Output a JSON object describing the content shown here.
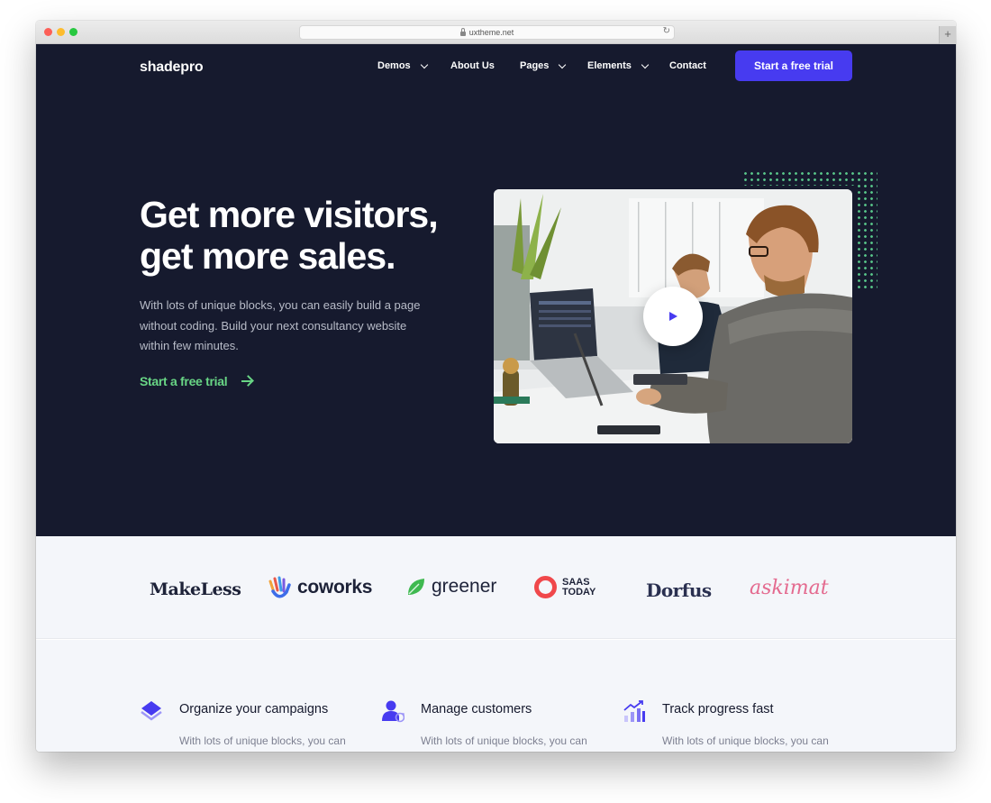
{
  "browser": {
    "url": "uxtheme.net"
  },
  "nav": {
    "logo": "shadepro",
    "items": [
      {
        "label": "Demos",
        "dropdown": true
      },
      {
        "label": "About Us",
        "dropdown": false
      },
      {
        "label": "Pages",
        "dropdown": true
      },
      {
        "label": "Elements",
        "dropdown": true
      },
      {
        "label": "Contact",
        "dropdown": false
      }
    ],
    "cta": "Start a free trial"
  },
  "hero": {
    "title_line1": "Get more visitors,",
    "title_line2": "get more sales.",
    "text": "With lots of unique blocks, you can easily build a page without coding. Build your next consultancy website within few minutes.",
    "link": "Start a free trial"
  },
  "brands": {
    "items": [
      "MakeLess",
      "coworks",
      "greener",
      "SAAS",
      "TODAY",
      "Dorfus",
      "askimat"
    ]
  },
  "features": [
    {
      "title": "Organize your campaigns",
      "text": "With lots of unique blocks, you can easily build a page without coding."
    },
    {
      "title": "Manage customers",
      "text": "With lots of unique blocks, you can easily build a page without coding."
    },
    {
      "title": "Track progress fast",
      "text": "With lots of unique blocks, you can easily build a page without coding."
    }
  ],
  "colors": {
    "hero_bg": "#161a2e",
    "accent": "#473bf0",
    "link_green": "#68d585",
    "light_bg": "#f4f6fa"
  }
}
